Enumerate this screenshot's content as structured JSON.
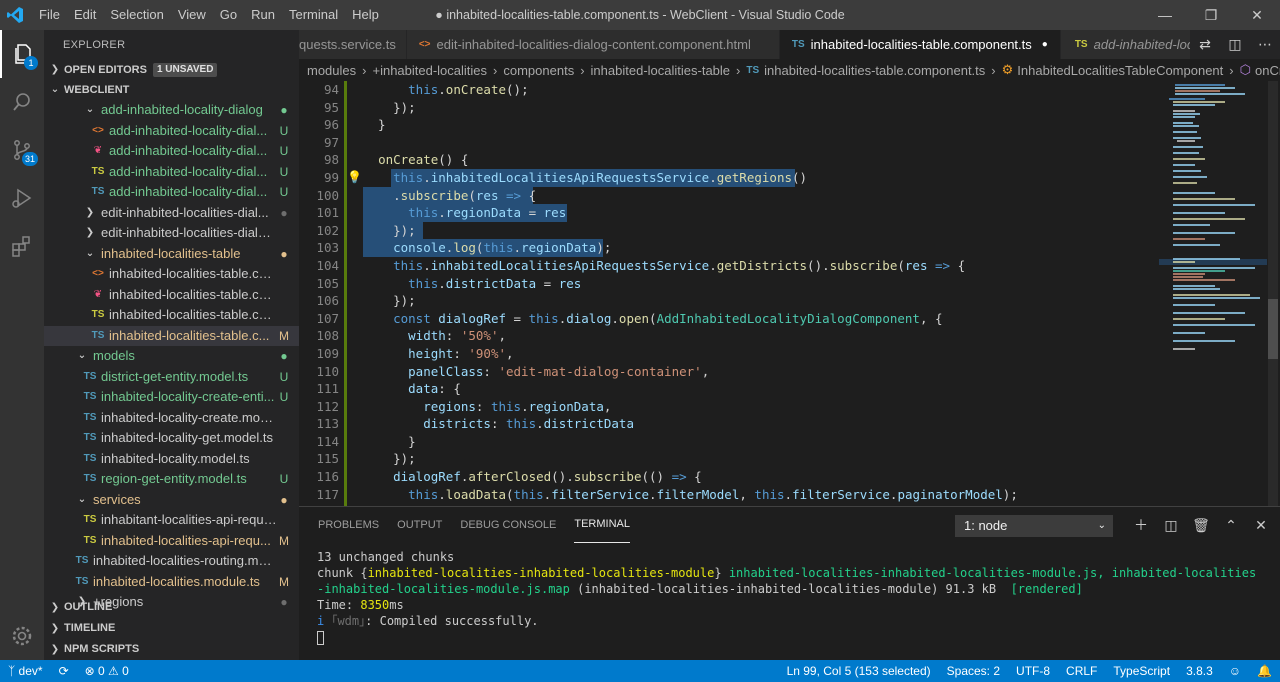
{
  "titlebar": {
    "menu": [
      "File",
      "Edit",
      "Selection",
      "View",
      "Go",
      "Run",
      "Terminal",
      "Help"
    ],
    "title": "● inhabited-localities-table.component.ts - WebClient - Visual Studio Code"
  },
  "activity": {
    "explorer_badge": "1",
    "scm_badge": "31"
  },
  "sidebar": {
    "header": "EXPLORER",
    "open_editors": "OPEN EDITORS",
    "unsaved": "1 UNSAVED",
    "workspace": "WEBCLIENT",
    "tree": [
      {
        "indent": 2,
        "type": "folder",
        "name": "add-inhabited-locality-dialog",
        "status": "●",
        "color": "green"
      },
      {
        "indent": 3,
        "type": "html",
        "name": "add-inhabited-locality-dial...",
        "status": "U",
        "color": "green"
      },
      {
        "indent": 3,
        "type": "scss",
        "name": "add-inhabited-locality-dial...",
        "status": "U",
        "color": "green"
      },
      {
        "indent": 3,
        "type": "tsy",
        "name": "add-inhabited-locality-dial...",
        "status": "U",
        "color": "green"
      },
      {
        "indent": 3,
        "type": "ts",
        "name": "add-inhabited-locality-dial...",
        "status": "U",
        "color": "green"
      },
      {
        "indent": 2,
        "type": "folder-closed",
        "name": "edit-inhabited-localities-dial...",
        "status": "●",
        "color": "white"
      },
      {
        "indent": 2,
        "type": "folder-closed",
        "name": "edit-inhabited-localities-dialog-co...",
        "status": "",
        "color": "white"
      },
      {
        "indent": 2,
        "type": "folder",
        "name": "inhabited-localities-table",
        "status": "●",
        "color": "orange"
      },
      {
        "indent": 3,
        "type": "html",
        "name": "inhabited-localities-table.compo...",
        "status": "",
        "color": "white"
      },
      {
        "indent": 3,
        "type": "scss",
        "name": "inhabited-localities-table.compo...",
        "status": "",
        "color": "white"
      },
      {
        "indent": 3,
        "type": "tsy",
        "name": "inhabited-localities-table.compo...",
        "status": "",
        "color": "white"
      },
      {
        "indent": 3,
        "type": "ts",
        "name": "inhabited-localities-table.c...",
        "status": "M",
        "color": "orange",
        "selected": true
      },
      {
        "indent": 1,
        "type": "folder",
        "name": "models",
        "status": "●",
        "color": "green"
      },
      {
        "indent": 2,
        "type": "ts",
        "name": "district-get-entity.model.ts",
        "status": "U",
        "color": "green"
      },
      {
        "indent": 2,
        "type": "ts",
        "name": "inhabited-locality-create-enti...",
        "status": "U",
        "color": "green"
      },
      {
        "indent": 2,
        "type": "ts",
        "name": "inhabited-locality-create.model.ts",
        "status": "",
        "color": "white"
      },
      {
        "indent": 2,
        "type": "ts",
        "name": "inhabited-locality-get.model.ts",
        "status": "",
        "color": "white"
      },
      {
        "indent": 2,
        "type": "ts",
        "name": "inhabited-locality.model.ts",
        "status": "",
        "color": "white"
      },
      {
        "indent": 2,
        "type": "ts",
        "name": "region-get-entity.model.ts",
        "status": "U",
        "color": "green"
      },
      {
        "indent": 1,
        "type": "folder",
        "name": "services",
        "status": "●",
        "color": "orange"
      },
      {
        "indent": 2,
        "type": "tsy",
        "name": "inhabitant-localities-api-requests....",
        "status": "",
        "color": "white"
      },
      {
        "indent": 2,
        "type": "tsy",
        "name": "inhabited-localities-api-requ...",
        "status": "M",
        "color": "orange"
      },
      {
        "indent": 1,
        "type": "ts",
        "name": "inhabited-localities-routing.module....",
        "status": "",
        "color": "white"
      },
      {
        "indent": 1,
        "type": "ts",
        "name": "inhabited-localities.module.ts",
        "status": "M",
        "color": "orange"
      },
      {
        "indent": 1,
        "type": "folder-closed",
        "name": "+regions",
        "status": "●",
        "color": "white"
      }
    ],
    "outline": "OUTLINE",
    "timeline": "TIMELINE",
    "npm": "NPM SCRIPTS"
  },
  "tabs": [
    {
      "icon": "",
      "label": "quests.service.ts",
      "active": false
    },
    {
      "icon": "<>",
      "label": "edit-inhabited-localities-dialog-content.component.html",
      "active": false
    },
    {
      "icon": "TS",
      "label": "inhabited-localities-table.component.ts",
      "active": true,
      "dirty": "●"
    },
    {
      "icon": "TS",
      "label": "add-inhabited-locality",
      "active": false,
      "italic": true
    }
  ],
  "breadcrumb": [
    "modules",
    "+inhabited-localities",
    "components",
    "inhabited-localities-table",
    "inhabited-localities-table.component.ts",
    "InhabitedLocalitiesTableComponent",
    "onCreate"
  ],
  "panel": {
    "tabs": [
      "PROBLEMS",
      "OUTPUT",
      "DEBUG CONSOLE",
      "TERMINAL"
    ],
    "active_tab": "TERMINAL",
    "terminal_select": "1: node",
    "terminal_lines": {
      "l1": "13 unchanged chunks",
      "l2a": "chunk {",
      "l2b": "inhabited-localities-inhabited-localities-module",
      "l2c": "} ",
      "l2d": "inhabited-localities-inhabited-localities-module.js, inhabited-localities",
      "l3a": "-inhabited-localities-module.js.map",
      "l3b": " (inhabited-localities-inhabited-localities-module) 91.3 kB  ",
      "l3c": "[rendered]",
      "l4a": "Time: ",
      "l4b": "8350",
      "l4c": "ms",
      "l5a": "i ",
      "l5b": "｢wdm｣",
      "l5c": ": Compiled successfully."
    }
  },
  "status": {
    "branch": "dev*",
    "sync": "⟳",
    "problems": "⊗ 0 ⚠ 0",
    "position": "Ln 99, Col 5 (153 selected)",
    "spaces": "Spaces: 2",
    "encoding": "UTF-8",
    "eol": "CRLF",
    "language": "TypeScript",
    "version": "3.8.3"
  },
  "colors": {
    "accent": "#007acc",
    "titlebar": "#3c3c3c",
    "sidebar": "#252526",
    "editor": "#1e1e1e"
  }
}
